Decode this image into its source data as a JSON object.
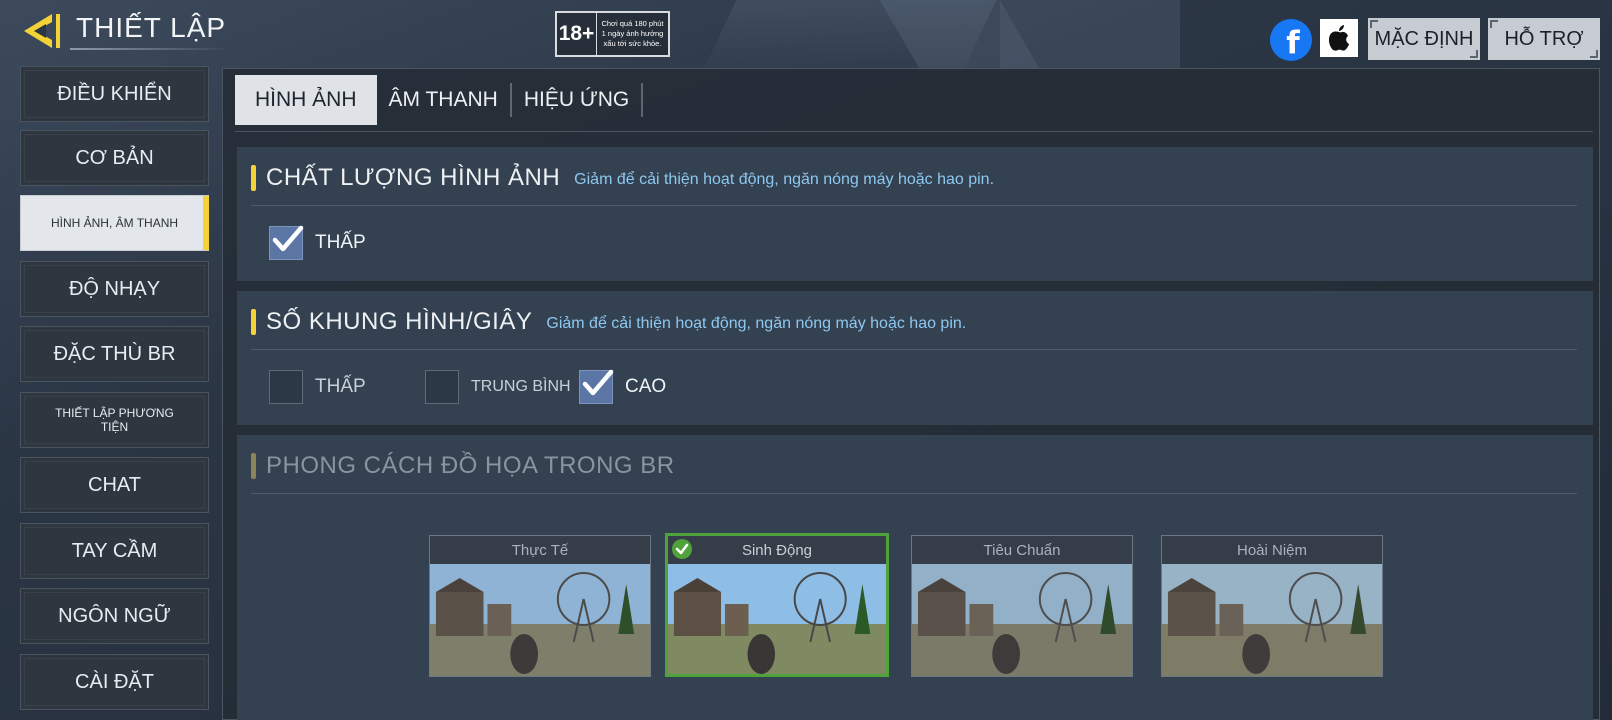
{
  "header": {
    "title": "THIẾT LẬP",
    "age_rating": "18+",
    "age_warning": "Chơi quá 180 phút 1 ngày ảnh hưởng xấu tới sức khỏe.",
    "facebook_glyph": "f",
    "default_label": "MẶC ĐỊNH",
    "support_label": "HỖ TRỢ"
  },
  "sidebar": {
    "items": [
      {
        "label": "ĐIỀU KHIỂN"
      },
      {
        "label": "CƠ BẢN"
      },
      {
        "label": "HÌNH ẢNH, ÂM THANH"
      },
      {
        "label": "ĐỘ NHẠY"
      },
      {
        "label": "ĐẶC THÙ BR"
      },
      {
        "label": "THIẾT LẬP PHƯƠNG TIỆN"
      },
      {
        "label": "CHAT"
      },
      {
        "label": "TAY CẦM"
      },
      {
        "label": "NGÔN NGỮ"
      },
      {
        "label": "CÀI ĐẶT"
      }
    ],
    "active_index": 2
  },
  "tabs": [
    {
      "label": "HÌNH ẢNH",
      "active": true
    },
    {
      "label": "ÂM THANH",
      "active": false
    },
    {
      "label": "HIỆU ỨNG",
      "active": false
    }
  ],
  "sections": {
    "quality": {
      "title": "CHẤT LƯỢNG HÌNH ẢNH",
      "desc": "Giảm để cải thiện hoạt động, ngăn nóng máy hoặc hao pin.",
      "options": [
        {
          "label": "THẤP",
          "checked": true
        }
      ]
    },
    "fps": {
      "title": "SỐ KHUNG HÌNH/GIÂY",
      "desc": "Giảm để cải thiện hoạt động, ngăn nóng máy hoặc hao pin.",
      "options": [
        {
          "label": "THẤP",
          "checked": false
        },
        {
          "label": "TRUNG BÌNH",
          "checked": false
        },
        {
          "label": "CAO",
          "checked": true
        }
      ]
    },
    "style": {
      "title": "PHONG CÁCH ĐỒ HỌA TRONG BR",
      "cards": [
        {
          "label": "Thực Tế",
          "selected": false
        },
        {
          "label": "Sinh Động",
          "selected": true
        },
        {
          "label": "Tiêu Chuẩn",
          "selected": false
        },
        {
          "label": "Hoài Niệm",
          "selected": false
        }
      ]
    }
  },
  "colors": {
    "accent": "#f5d235",
    "checkbox_checked": "#5b76a5",
    "selected_border": "#4fa33a",
    "desc_text": "#8ec8f0"
  },
  "icons": {
    "back": "back-arrow-icon",
    "facebook": "facebook-icon",
    "apple": "apple-icon",
    "check": "checkmark-icon"
  }
}
